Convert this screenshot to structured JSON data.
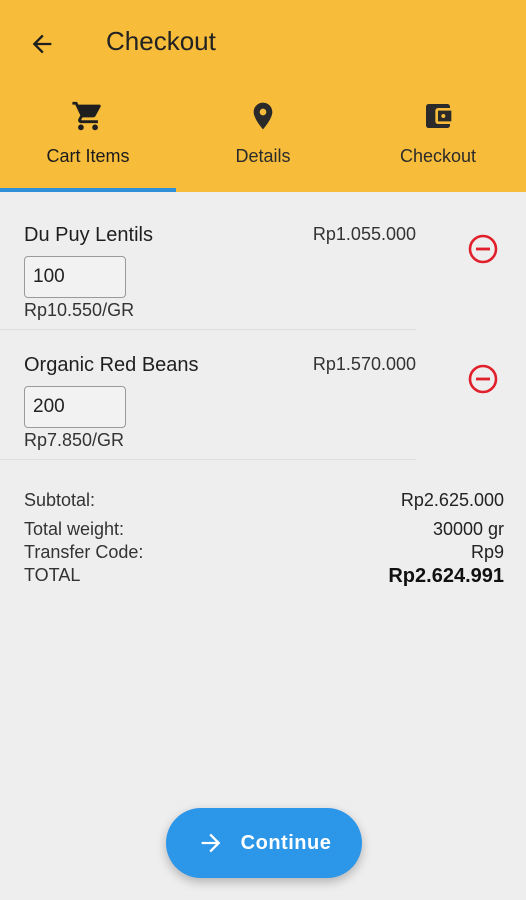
{
  "appbar": {
    "title": "Checkout",
    "back_icon": "arrow-left-icon",
    "color": "#f6bc3a"
  },
  "tabs": [
    {
      "label": "Cart Items",
      "icon": "shopping-cart-icon",
      "active": true
    },
    {
      "label": "Details",
      "icon": "location-pin-icon",
      "active": false
    },
    {
      "label": "Checkout",
      "icon": "wallet-icon",
      "active": false
    }
  ],
  "cart": {
    "items": [
      {
        "name": "Du Puy Lentils",
        "price": "Rp1.055.000",
        "quantity": "100",
        "unit_price": "Rp10.550/GR"
      },
      {
        "name": "Organic Red Beans",
        "price": "Rp1.570.000",
        "quantity": "200",
        "unit_price": "Rp7.850/GR"
      }
    ],
    "remove_icon": "remove-circle-icon",
    "remove_color": "#e0202a"
  },
  "summary": {
    "subtotal_label": "Subtotal:",
    "subtotal_value": "Rp2.625.000",
    "weight_label": "Total weight:",
    "weight_value": "30000 gr",
    "transfer_label": "Transfer Code:",
    "transfer_value": "Rp9",
    "total_label": "TOTAL",
    "total_value": "Rp2.624.991"
  },
  "continue_button": {
    "label": "Continue",
    "icon": "arrow-right-icon",
    "color": "#2c96e8"
  }
}
